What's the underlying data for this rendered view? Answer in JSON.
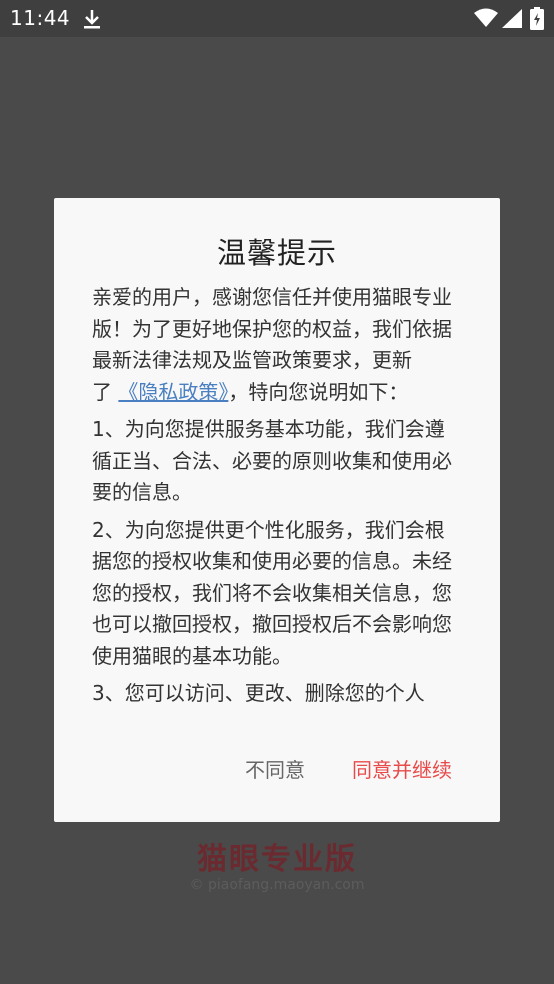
{
  "status_bar": {
    "time": "11:44",
    "icons": [
      "download-icon",
      "wifi-icon",
      "signal-icon",
      "battery-icon"
    ]
  },
  "background": {
    "brand": "猫眼专业版",
    "url": "© piaofang.maoyan.com"
  },
  "dialog": {
    "title": "温馨提示",
    "intro_before_link": "亲爱的用户，感谢您信任并使用猫眼专业版！为了更好地保护您的权益，我们依据最新法律法规及监管政策要求，更新了",
    "policy_link": "《隐私政策》",
    "intro_after_link": "，特向您说明如下：",
    "item1": "1、为向您提供服务基本功能，我们会遵循正当、合法、必要的原则收集和使用必要的信息。",
    "item2": "2、为向您提供更个性化服务，我们会根据您的授权收集和使用必要的信息。未经您的授权，我们将不会收集相关信息，您也可以撤回授权，撤回授权后不会影响您使用猫眼的基本功能。",
    "item3": "3、您可以访问、更改、删除您的个人",
    "disagree_label": "不同意",
    "agree_label": "同意并继续"
  },
  "colors": {
    "accent": "#e84a4a",
    "link": "#4a7fc1",
    "brand": "#6b2a2f"
  }
}
